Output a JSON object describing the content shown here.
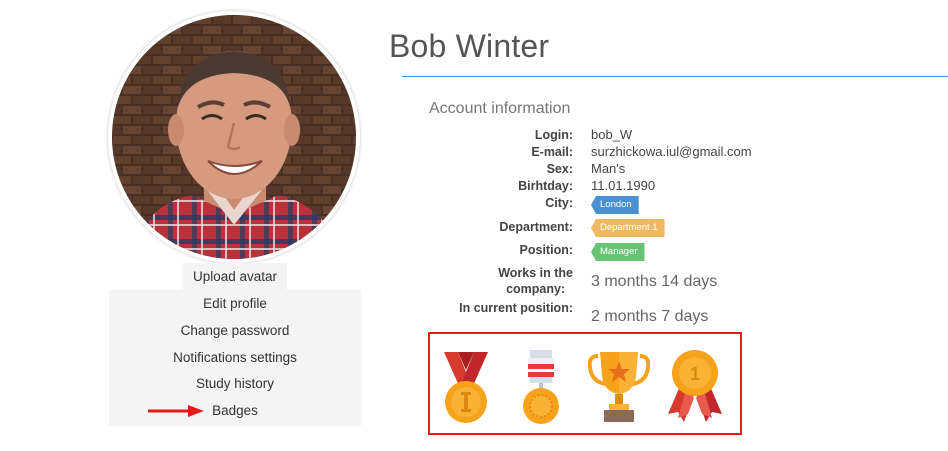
{
  "profile": {
    "name": "Bob Winter",
    "upload_avatar_label": "Upload avatar"
  },
  "menu": {
    "items": [
      {
        "label": "Edit profile"
      },
      {
        "label": "Change password"
      },
      {
        "label": "Notifications settings"
      },
      {
        "label": "Study history"
      },
      {
        "label": "Badges"
      }
    ]
  },
  "account": {
    "section_title": "Account information",
    "login_label": "Login:",
    "login": "bob_W",
    "email_label": "E-mail:",
    "email": "surzhickowa.iul@gmail.com",
    "sex_label": "Sex:",
    "sex": "Man's",
    "birthday_label": "Birhtday:",
    "birthday": "11.01.1990",
    "city_label": "City:",
    "city": "London",
    "department_label": "Department:",
    "department": "Department 1",
    "position_label": "Position:",
    "position": "Manager",
    "works_label_line1": "Works in the",
    "works_label_line2": "company:",
    "works_value": "3 months 14 days",
    "current_position_label": "In current position:",
    "current_position_value": "2 months 7 days"
  },
  "colors": {
    "city_tag": "#4a90d0",
    "department_tag": "#f0b860",
    "position_tag": "#66c472",
    "highlight_border": "#e41b1b",
    "title_rule": "#4a8cc4"
  },
  "badges": [
    {
      "icon": "medal-ribbon-icon"
    },
    {
      "icon": "military-medal-icon"
    },
    {
      "icon": "trophy-icon"
    },
    {
      "icon": "rosette-first-place-icon"
    }
  ]
}
